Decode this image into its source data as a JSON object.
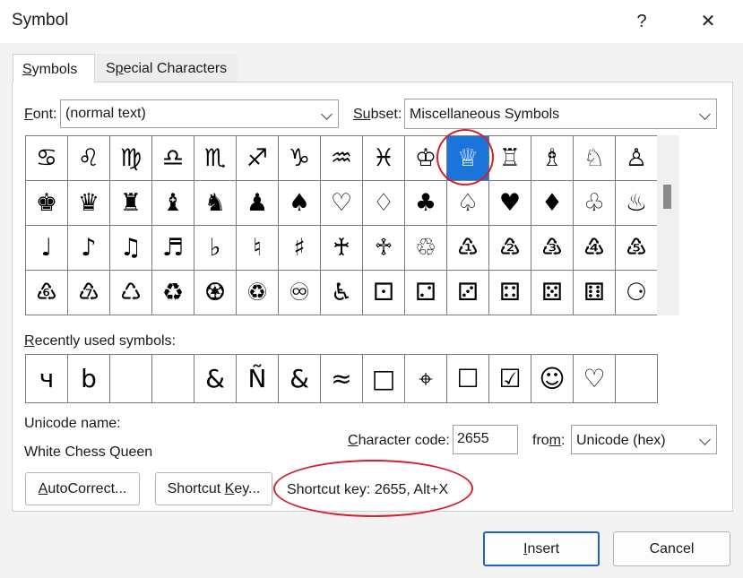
{
  "window": {
    "title": "Symbol",
    "help": "?",
    "close": "✕"
  },
  "tabs": [
    {
      "label_u": "S",
      "label_rest": "ymbols"
    },
    {
      "label_pre": "S",
      "label_u": "p",
      "label_rest": "ecial Characters"
    }
  ],
  "font": {
    "label_u": "F",
    "label_rest": "ont:",
    "value": "(normal text)"
  },
  "subset": {
    "label_u": "Su",
    "label_rest": "bset:",
    "value": "Miscellaneous Symbols"
  },
  "symbols": [
    [
      "♋",
      "♌",
      "♍",
      "♎",
      "♏",
      "♐",
      "♑",
      "♒",
      "♓",
      "♔",
      "♕",
      "♖",
      "♗",
      "♘",
      "♙"
    ],
    [
      "♚",
      "♛",
      "♜",
      "♝",
      "♞",
      "♟",
      "♠",
      "♡",
      "♢",
      "♣",
      "♤",
      "♥",
      "♦",
      "♧",
      "♨"
    ],
    [
      "♩",
      "♪",
      "♫",
      "♬",
      "♭",
      "♮",
      "♯",
      "♰",
      "♱",
      "♲",
      "♳",
      "♴",
      "♵",
      "♶",
      "♷"
    ],
    [
      "♸",
      "♹",
      "♺",
      "♻",
      "♼",
      "♽",
      "♾",
      "♿",
      "⚀",
      "⚁",
      "⚂",
      "⚃",
      "⚄",
      "⚅",
      "⚆"
    ]
  ],
  "selected": {
    "row": 0,
    "col": 10
  },
  "recent": {
    "label_u": "R",
    "label_rest": "ecently used symbols:",
    "items": [
      "ч",
      "b",
      "",
      "",
      "&",
      "Ñ",
      "&",
      "≈",
      "□",
      "⌖",
      "☐",
      "☑",
      "☺",
      "♡",
      ""
    ]
  },
  "unicode_name": {
    "label": "Unicode name:",
    "value": "White Chess Queen"
  },
  "char_code": {
    "label_u": "C",
    "label_rest": "haracter code:",
    "value": "2655"
  },
  "from": {
    "label_pre": "fro",
    "label_u": "m",
    "label_rest": ":",
    "value": "Unicode (hex)"
  },
  "buttons": {
    "autocorrect_u": "A",
    "autocorrect_rest": "utoCorrect...",
    "shortcut_pre": "Shortcut ",
    "shortcut_u": "K",
    "shortcut_rest": "ey...",
    "insert_u": "I",
    "insert_rest": "nsert",
    "cancel": "Cancel"
  },
  "shortcut_info": "Shortcut key: 2655, Alt+X",
  "colors": {
    "selection": "#1a74d9",
    "highlight_ring": "#d4202f"
  }
}
